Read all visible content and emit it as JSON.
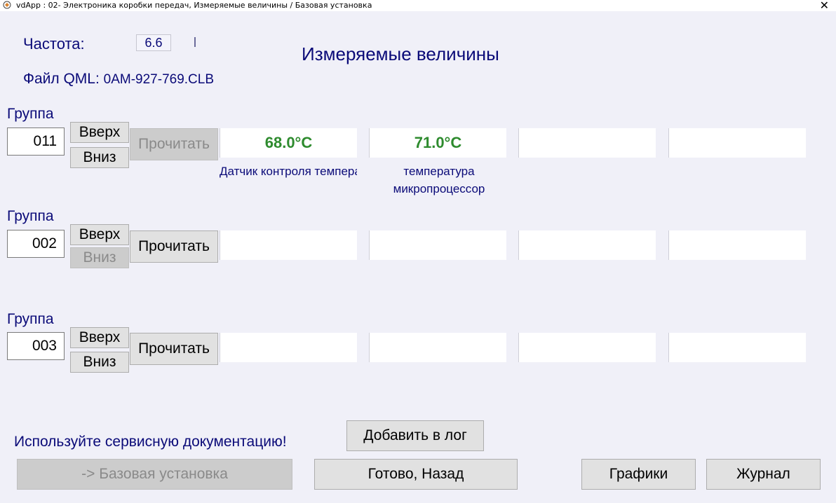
{
  "window": {
    "title": "vdApp : 02- Электроника коробки передач,  Измеряемые величины / Базовая установка",
    "close_glyph": "✕"
  },
  "header": {
    "freq_label": "Частота:",
    "freq_value": "6.6",
    "title": "Измеряемые величины",
    "qml_label": "Файл QML: ",
    "qml_file": "0AM-927-769.CLB"
  },
  "groups": [
    {
      "label": "Группа",
      "number": "011",
      "up_label": "Вверх",
      "down_label": "Вниз",
      "read_label": "Прочитать",
      "fields": [
        "68.0°C",
        "71.0°C",
        "",
        ""
      ],
      "descriptions": [
        "Датчик контроля температуры",
        "температура микропроцессор",
        "",
        ""
      ]
    },
    {
      "label": "Группа",
      "number": "002",
      "up_label": "Вверх",
      "down_label": "Вниз",
      "read_label": "Прочитать",
      "fields": [
        "",
        "",
        "",
        ""
      ]
    },
    {
      "label": "Группа",
      "number": "003",
      "up_label": "Вверх",
      "down_label": "Вниз",
      "read_label": "Прочитать",
      "fields": [
        "",
        "",
        "",
        ""
      ]
    }
  ],
  "footer": {
    "note": "Используйте сервисную документацию!",
    "add_log": "Добавить в лог",
    "basic_setting": "-> Базовая установка",
    "done_back": "Готово, Назад",
    "graphs": "Графики",
    "journal": "Журнал"
  },
  "colors": {
    "label_text": "#0a0a78",
    "value_text": "#2e8b2e",
    "background": "#f0f0f8"
  }
}
